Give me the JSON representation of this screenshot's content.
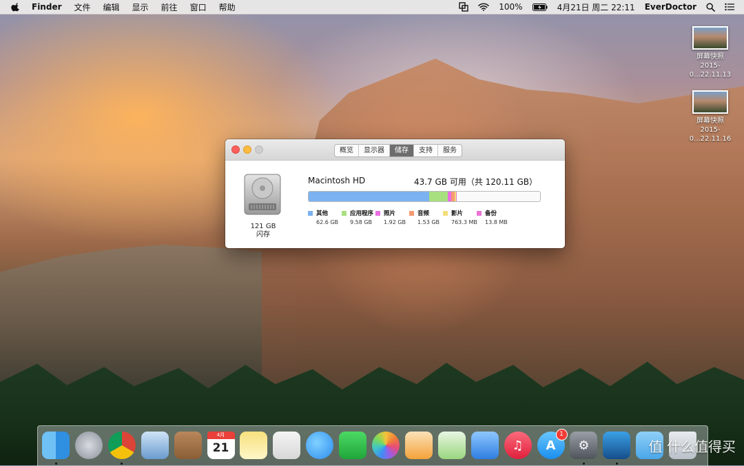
{
  "menubar": {
    "app_name": "Finder",
    "menus": [
      "文件",
      "编辑",
      "显示",
      "前往",
      "窗口",
      "帮助"
    ],
    "battery": "100%",
    "datetime": "4月21日 周二  22:11",
    "user": "EverDoctor"
  },
  "desktop_icons": [
    {
      "name": "屏幕快照",
      "sub": "2015-0...22.11.13"
    },
    {
      "name": "屏幕快照",
      "sub": "2015-0...22.11.16"
    }
  ],
  "window": {
    "tabs": [
      "概览",
      "显示器",
      "储存",
      "支持",
      "服务"
    ],
    "active_tab": "储存",
    "disk": {
      "capacity": "121 GB",
      "type": "闪存",
      "name": "Macintosh HD",
      "free_text": "43.7 GB 可用（共 120.11 GB）"
    },
    "storage": [
      {
        "label": "其他",
        "value": "62.6 GB",
        "color": "#7bb2f0",
        "gb": 62.6
      },
      {
        "label": "应用程序",
        "value": "9.58 GB",
        "color": "#a8e07f",
        "gb": 9.58
      },
      {
        "label": "照片",
        "value": "1.92 GB",
        "color": "#ea6de2",
        "gb": 1.92
      },
      {
        "label": "音频",
        "value": "1.53 GB",
        "color": "#f59a72",
        "gb": 1.53
      },
      {
        "label": "影片",
        "value": "763.3 MB",
        "color": "#f3de7a",
        "gb": 0.763
      },
      {
        "label": "备份",
        "value": "13.8 MB",
        "color": "#ec73d6",
        "gb": 0.0138
      }
    ],
    "total_gb": 120.11
  },
  "dock": {
    "items": [
      {
        "name": "finder",
        "glyph": "",
        "running": true
      },
      {
        "name": "launchpad",
        "glyph": "",
        "running": false
      },
      {
        "name": "chrome",
        "glyph": "",
        "running": true
      },
      {
        "name": "mail",
        "glyph": "",
        "running": false
      },
      {
        "name": "contacts",
        "glyph": "",
        "running": false
      },
      {
        "name": "calendar",
        "glyph": "21",
        "running": false
      },
      {
        "name": "notes",
        "glyph": "",
        "running": false
      },
      {
        "name": "reminders",
        "glyph": "",
        "running": false
      },
      {
        "name": "messages",
        "glyph": "",
        "running": false
      },
      {
        "name": "facetime",
        "glyph": "",
        "running": false
      },
      {
        "name": "photos",
        "glyph": "",
        "running": false
      },
      {
        "name": "pages",
        "glyph": "",
        "running": false
      },
      {
        "name": "numbers",
        "glyph": "",
        "running": false
      },
      {
        "name": "keynote",
        "glyph": "",
        "running": false
      },
      {
        "name": "itunes",
        "glyph": "♫",
        "running": false
      },
      {
        "name": "app-store",
        "glyph": "A",
        "running": false,
        "badge": "1"
      },
      {
        "name": "system-preferences",
        "glyph": "⚙",
        "running": true
      },
      {
        "name": "ever-app",
        "glyph": "",
        "running": true
      },
      {
        "name": "downloads-folder",
        "glyph": "",
        "running": false
      },
      {
        "name": "trash",
        "glyph": "",
        "running": false
      }
    ],
    "calendar_month": "4月",
    "watermark": "值 什么值得买"
  }
}
